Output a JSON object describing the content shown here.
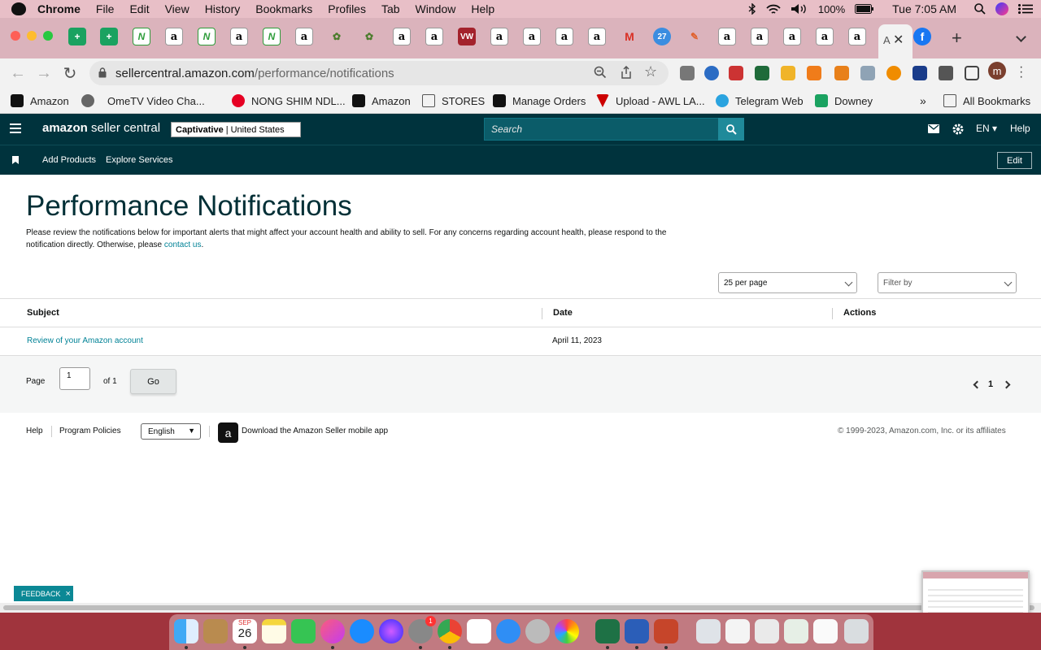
{
  "menubar": {
    "app": "Chrome",
    "items": [
      "File",
      "Edit",
      "View",
      "History",
      "Bookmarks",
      "Profiles",
      "Tab",
      "Window",
      "Help"
    ],
    "battery": "100%",
    "clock": "Tue 7:05 AM"
  },
  "browser": {
    "url_host": "sellercentral.amazon.com",
    "url_path": "/performance/notifications",
    "profile_initial": "m",
    "active_tab_letter": "A"
  },
  "bookmarks": [
    {
      "label": "Amazon"
    },
    {
      "label": "OmeTV Video Cha..."
    },
    {
      "label": "NONG SHIM NDL..."
    },
    {
      "label": "Amazon"
    },
    {
      "label": "STORES"
    },
    {
      "label": "Manage Orders"
    },
    {
      "label": "Upload - AWL LA..."
    },
    {
      "label": "Telegram Web"
    },
    {
      "label": "Downey"
    }
  ],
  "bookmarks_overflow": "»",
  "all_bookmarks": "All Bookmarks",
  "seller": {
    "logo_brand": "amazon",
    "logo_rest": " seller central",
    "store_name": "Captivative",
    "marketplace": "United States",
    "search_placeholder": "Search",
    "language": "EN",
    "help": "Help",
    "subnav": {
      "add_products": "Add Products",
      "explore_services": "Explore Services",
      "edit": "Edit"
    }
  },
  "page": {
    "title": "Performance Notifications",
    "description_pre": "Please review the notifications below for important alerts that might affect your account health and ability to sell. For any concerns regarding account health, please respond to the notification directly. Otherwise, please ",
    "description_link": "contact us",
    "description_post": ".",
    "per_page": "25 per page",
    "filter": "Filter by",
    "columns": {
      "subject": "Subject",
      "date": "Date",
      "actions": "Actions"
    },
    "rows": [
      {
        "subject": "Review of your Amazon account",
        "date": "April 11, 2023"
      }
    ],
    "pager": {
      "page_label": "Page",
      "current": "1",
      "of": "of 1",
      "go": "Go",
      "page_number": "1"
    }
  },
  "footer": {
    "help": "Help",
    "program_policies": "Program Policies",
    "language": "English",
    "download_app": "Download the Amazon Seller mobile app",
    "copyright": "© 1999-2023, Amazon.com, Inc. or its affiliates"
  },
  "feedback": {
    "label": "FEEDBACK",
    "close": "×"
  },
  "dock": {
    "calendar_month": "SEP",
    "calendar_day": "26",
    "badge": "1"
  },
  "colors": {
    "header_bg": "#00333d",
    "link": "#008296",
    "title": "#002f36",
    "feedback": "#0b8895",
    "menubar": "#e8bfc7"
  }
}
